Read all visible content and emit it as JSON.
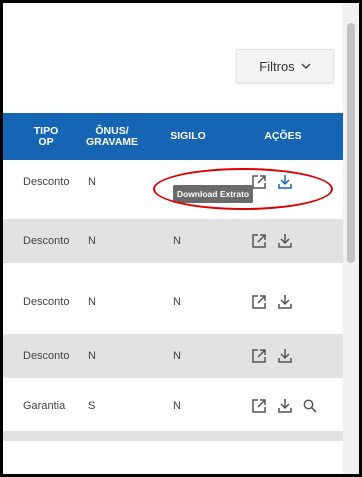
{
  "filter": {
    "label": "Filtros"
  },
  "table": {
    "headers": {
      "tipo_op": "TIPO\nOP",
      "onus": "ÔNUS/\nGRAVAME",
      "sigilo": "SIGILO",
      "acoes": "AÇÕES"
    },
    "rows": [
      {
        "tipo": "Desconto",
        "onus": "N",
        "sigilo": ""
      },
      {
        "tipo": "Desconto",
        "onus": "N",
        "sigilo": "N"
      },
      {
        "tipo": "Desconto",
        "onus": "N",
        "sigilo": "N"
      },
      {
        "tipo": "Desconto",
        "onus": "N",
        "sigilo": "N"
      },
      {
        "tipo": "Garantia",
        "onus": "S",
        "sigilo": "N"
      }
    ]
  },
  "tooltip": {
    "text": "Download Extrato"
  },
  "colors": {
    "header_bg": "#1565b4",
    "row_gray": "#e2e2e2",
    "highlight": "#e00000",
    "download_icon": "#1565b4",
    "tooltip_bg": "#6a6a6a"
  },
  "icons": {
    "open": "external-link-icon",
    "download": "download-icon",
    "search": "search-icon",
    "filter_chevron": "chevron-down-icon"
  }
}
